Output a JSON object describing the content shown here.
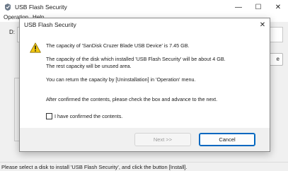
{
  "window": {
    "title": "USB Flash Security",
    "menu": [
      "Operation",
      "Help"
    ],
    "drive_label": "D:",
    "side_button_label": "e",
    "status_text": "Please select a disk to install 'USB Flash Security', and click the button [Install]."
  },
  "dialog": {
    "title": "USB Flash Security",
    "messages": [
      "The capacity of 'SanDisk Cruzer Blade USB Device' is 7.45 GB.",
      "The capacity of the disk which installed 'USB Flash Security' will be about 4 GB.",
      "The rest capacity will be unused area.",
      "You can return the capacity by [Uninstallation] in 'Operation' menu.",
      "After confirmed the contents, please check the box and advance to the next."
    ],
    "checkbox_label": "I have confirmed the contents.",
    "checkbox_checked": false,
    "next_label": "Next >>",
    "cancel_label": "Cancel",
    "close_glyph": "✕"
  },
  "window_controls": {
    "minimize": "—",
    "maximize": "☐",
    "close": "✕"
  },
  "icons": {
    "app": "usb-shield-icon",
    "dialog": "warning-icon"
  },
  "colors": {
    "accent": "#0067c0",
    "warning_fill": "#f2c811"
  }
}
